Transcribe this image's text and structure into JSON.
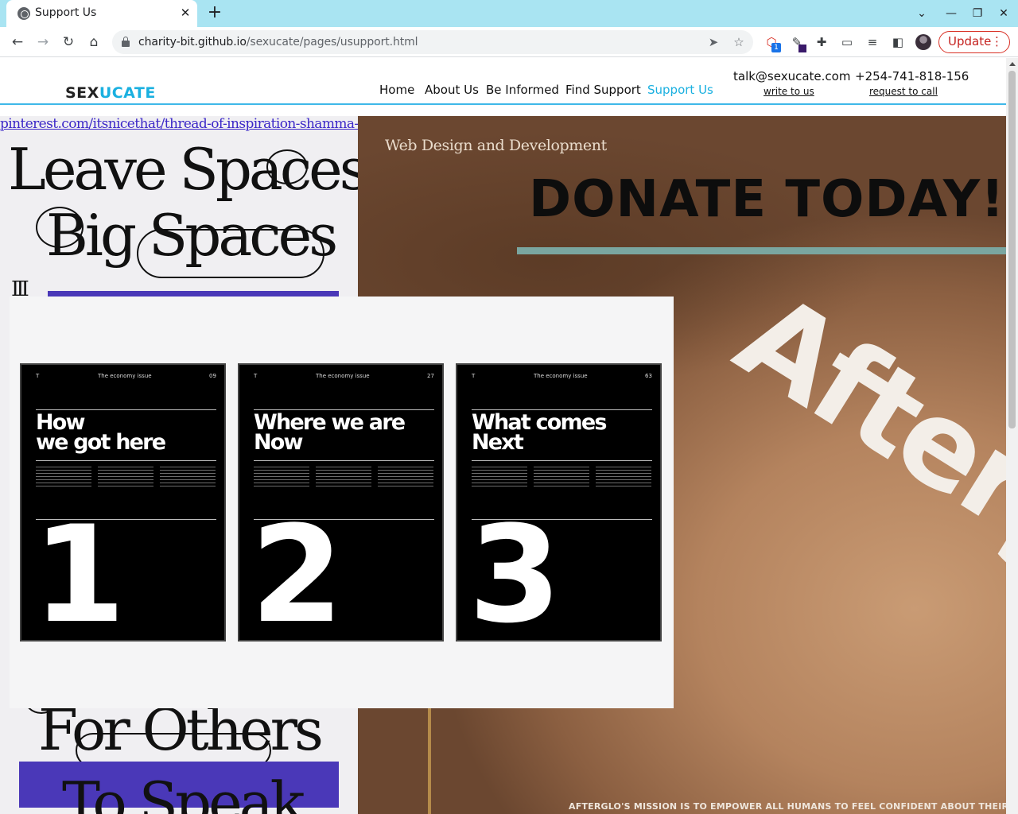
{
  "browser": {
    "tab_title": "Support Us",
    "tab_close": "✕",
    "new_tab": "+",
    "url_host": "charity-bit.github.io",
    "url_path": "/sexucate/pages/usupport.html",
    "update_label": "Update",
    "extension_badge": "1",
    "icons": [
      "back-arrow-icon",
      "forward-arrow-icon",
      "reload-icon",
      "home-icon",
      "lock-icon",
      "send-icon",
      "star-icon",
      "extension-icon",
      "puzzle-icon",
      "cast-icon",
      "media-icon",
      "sidebar-icon",
      "avatar",
      "menu-dots-icon"
    ]
  },
  "site": {
    "logo_part1": "SEX",
    "logo_part2": "UCATE",
    "nav": [
      "Home",
      "About Us",
      "Be Informed",
      "Find Support",
      "Support Us"
    ],
    "active_nav": "Support Us",
    "email": "talk@sexucate.com",
    "email_link": "write to us",
    "phone": "+254-741-818-156",
    "phone_link": "request to call",
    "accent_color": "#1ab0e0"
  },
  "left_poster": {
    "source_link": "pinterest.com/itsnicethat/thread-of-inspiration-shamma-buhazza",
    "line1": "Leave Spaces,",
    "line2": "Big Spaces",
    "line3": "For Others",
    "line4": "To Speak"
  },
  "hero": {
    "kicker": "Web Design and Development",
    "title": "DONATE TODAY!",
    "brand": "Afterg",
    "mission": "AFTERGLO'S MISSION IS TO EMPOWER ALL HUMANS TO FEEL CONFIDENT ABOUT THEIR SENSI"
  },
  "posters": [
    {
      "meta_left": "T",
      "meta_center": "The economy issue",
      "meta_right": "09",
      "heading_1": "How",
      "heading_2": "we got here",
      "number": "1"
    },
    {
      "meta_left": "T",
      "meta_center": "The economy issue",
      "meta_right": "27",
      "heading_1": "Where we are",
      "heading_2": "Now",
      "number": "2"
    },
    {
      "meta_left": "T",
      "meta_center": "The economy issue",
      "meta_right": "63",
      "heading_1": "What comes",
      "heading_2": "Next",
      "number": "3"
    }
  ]
}
